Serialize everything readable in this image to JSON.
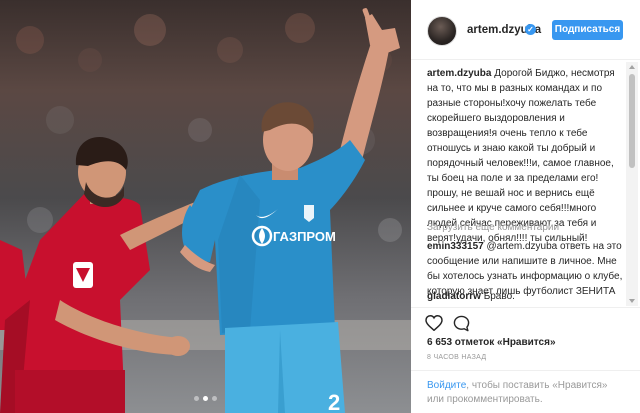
{
  "profile": {
    "username": "artem.dzyuba",
    "verified_mark": "✓",
    "follow_label": "Подписаться"
  },
  "post": {
    "caption_author": "artem.dzyuba",
    "caption_text": "Дорогой Биджо, несмотря на то, что мы в разных командах и по разные стороны!хочу пожелать тебе скорейшего выздоровления и возвращения!я очень тепло к тебе отношусь и знаю какой ты добрый и порядочный человек!!!и, самое главное, ты боец на поле и за пределами его! прошу, не вешай нос и вернись ещё сильнее и круче самого себя!!!много людей сейчас переживают за тебя и верят!удачи, обнял!!!! ты сильный!",
    "load_more": "Загрузить еще комментарии",
    "comments": [
      {
        "author": "emin333157",
        "text": "@artem.dzyuba ответь на это сообщение или напишите в личное. Мне бы хотелось узнать информацию о клубе, которую знает лишь футболист ЗЕНИТА"
      },
      {
        "author": "gladiatorrw",
        "text": "Браво."
      }
    ],
    "likes": "6 653 отметок «Нравится»",
    "time": "8 ЧАСОВ НАЗАД",
    "photo_texts": {
      "sponsor": "ГАЗПРОМ",
      "number": "2"
    },
    "carousel_dots": 3,
    "carousel_active": 1
  },
  "footer": {
    "login_link": "Войдите",
    "login_rest": ", чтобы поставить «Нравится» или прокомментировать."
  },
  "icons": {
    "heart": "heart-icon",
    "comment": "comment-icon",
    "verified": "verified-badge-icon"
  },
  "colors": {
    "accent": "#3897f0",
    "muted": "#999999",
    "zenit_blue": "#2a8fc9",
    "spartak_red": "#c8102e"
  }
}
